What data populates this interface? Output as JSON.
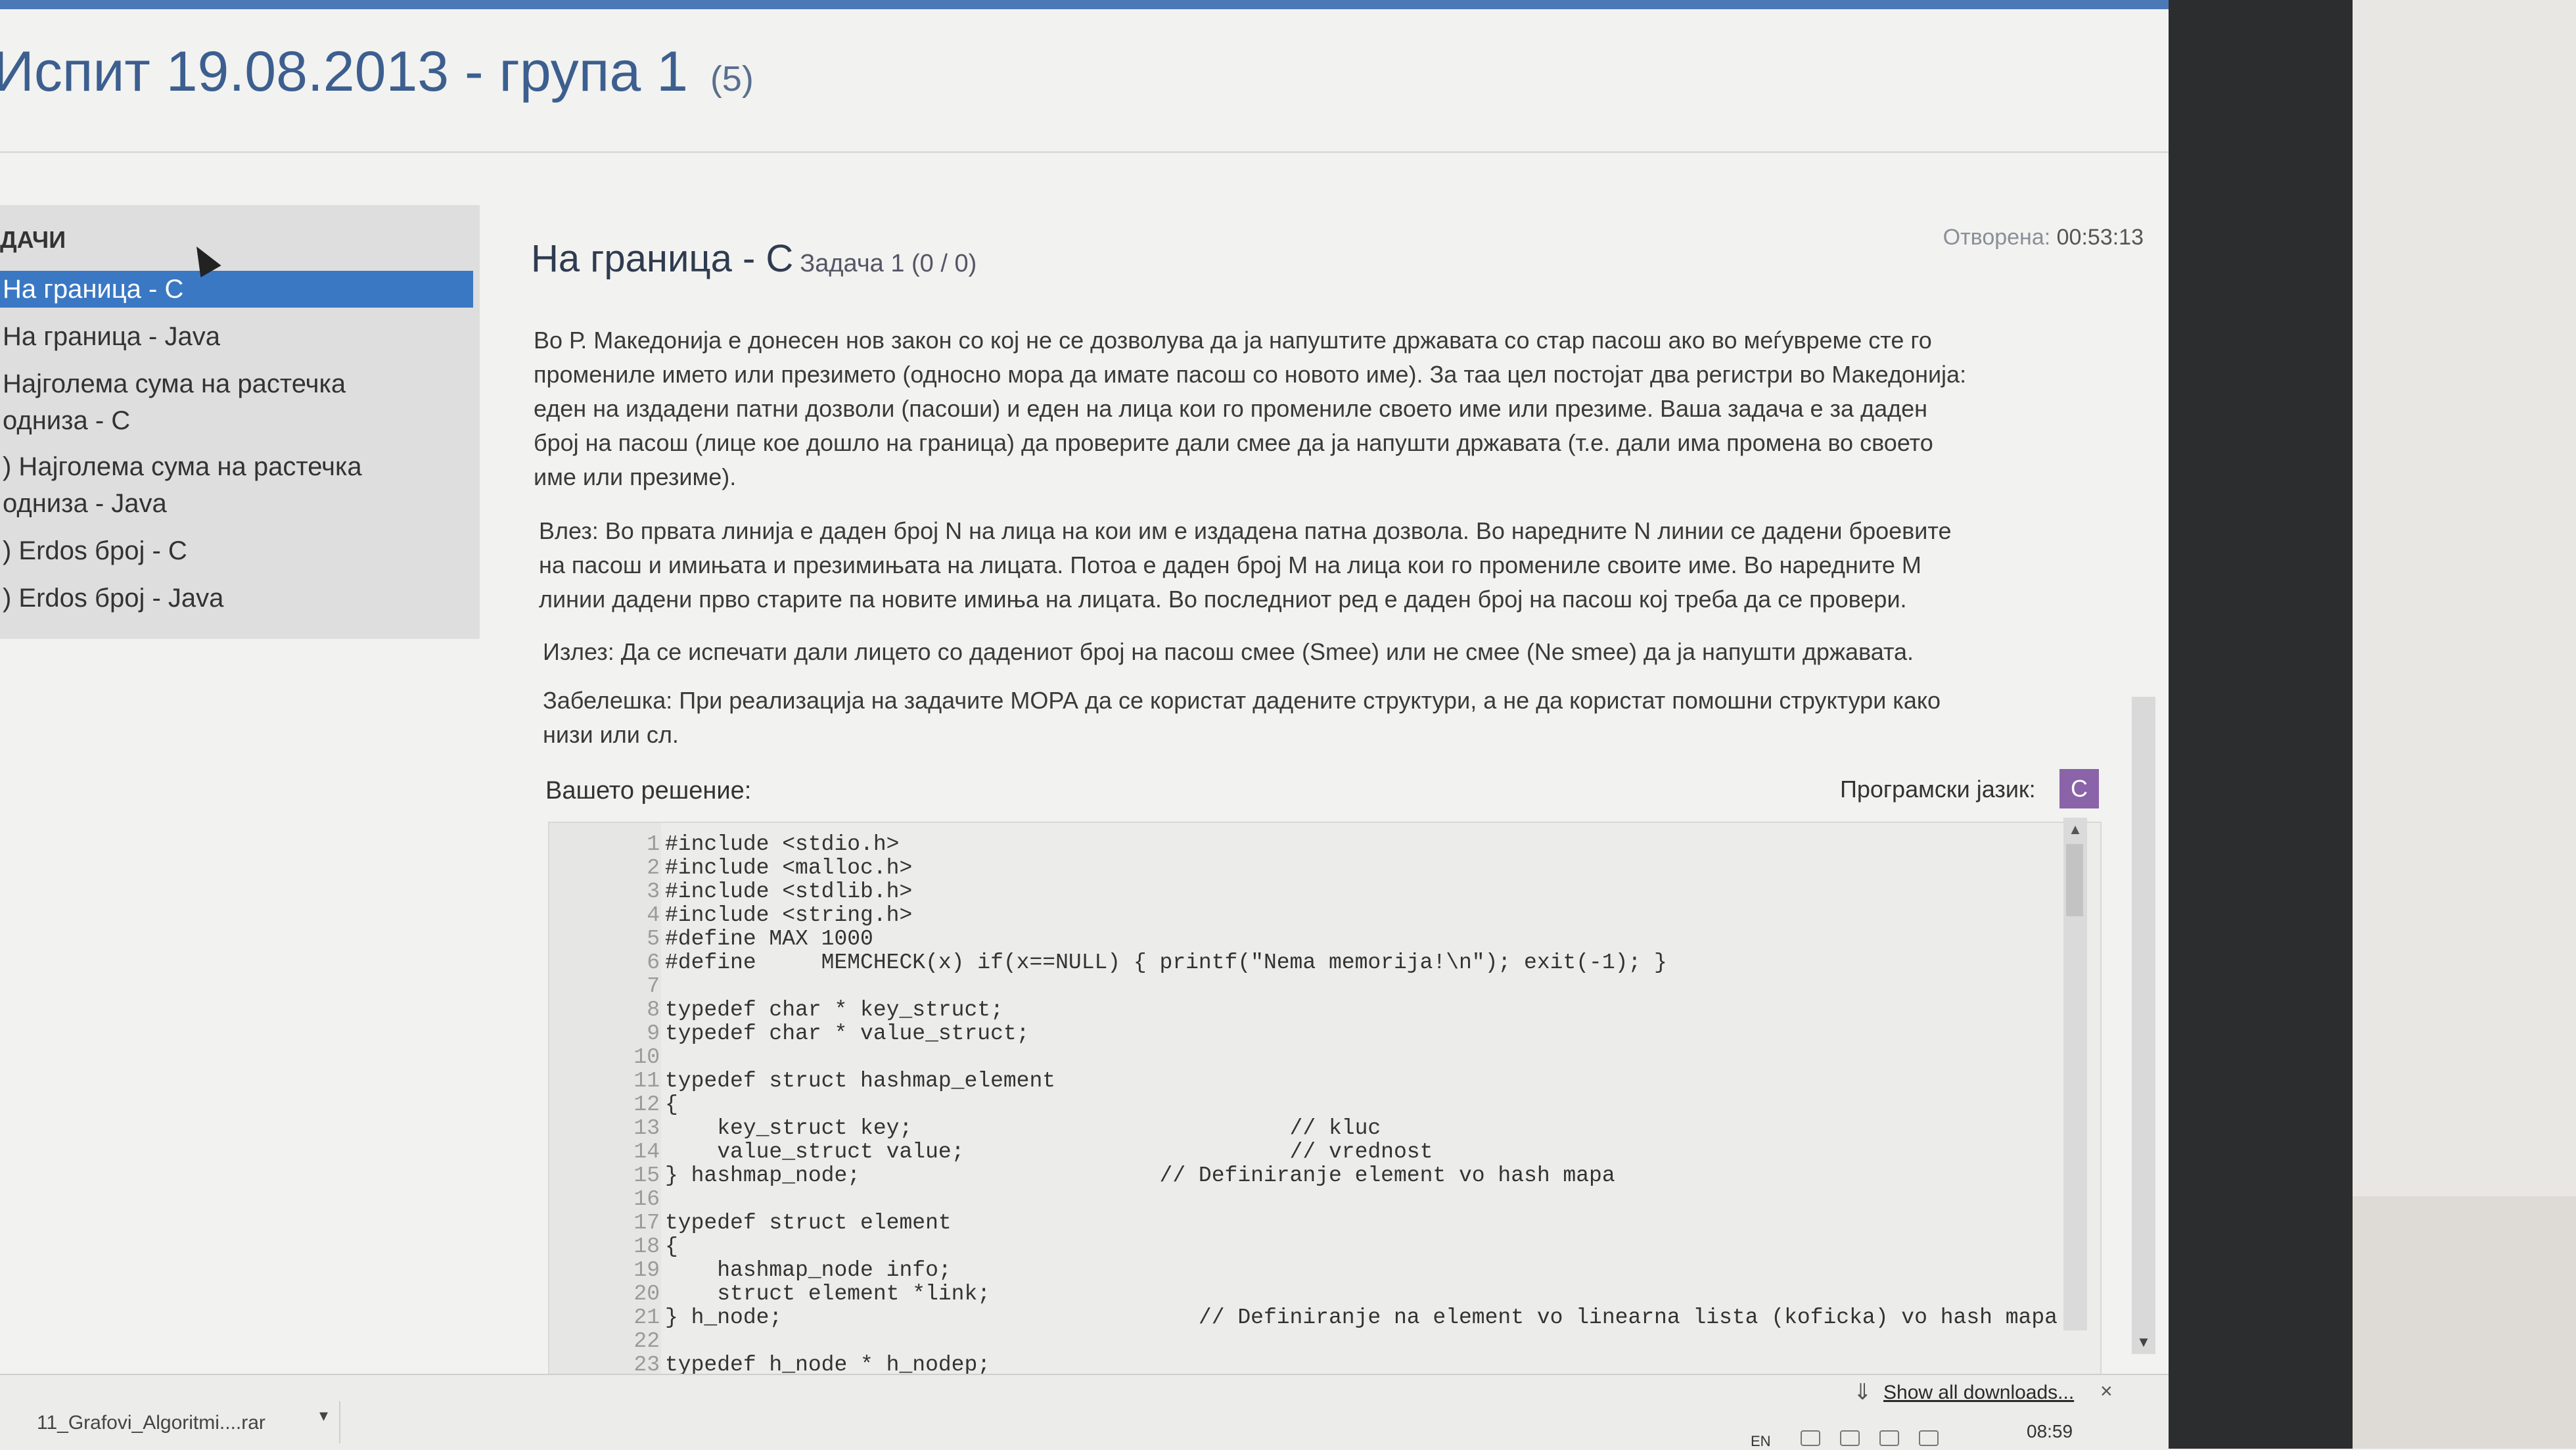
{
  "exam": {
    "title": "Испит 19.08.2013 - група 1",
    "count": "(5)"
  },
  "sidebar": {
    "heading": "ДАЧИ",
    "items": [
      {
        "label": "На граница - C"
      },
      {
        "label": "На граница - Java"
      },
      {
        "label": "Најголема сума на растечка"
      },
      {
        "label": "одниза - C"
      },
      {
        "label": ") Најголема сума на растечка"
      },
      {
        "label": "одниза - Java"
      },
      {
        "label": ") Erdos број - C"
      },
      {
        "label": ") Erdos број - Java"
      }
    ]
  },
  "task": {
    "title": "На граница - C",
    "subtitle": "Задача 1 (0 / 0)",
    "opened_label": "Отворена:",
    "opened_time": "00:53:13",
    "description": [
      "Во Р. Македонија е донесен нов закон со кој не се дозволува да ја напуштите државата со стар пасош ако во меѓувреме сте го",
      "промениле името или презимето (односно мора да имате пасош со новото име). За таа цел постојат два регистри во Македонија:",
      "еден на издадени патни дозволи (пасоши) и еден на лица кои го промениле своето име или презиме. Ваша задача е за даден",
      "број на пасош (лице кое дошло на граница) да проверите дали смее да ја напушти државата (т.е. дали има промена во своето",
      "име или презиме)."
    ],
    "input": [
      "Влез: Во првата линија е даден број N на лица на кои им е издадена патна дозвола. Во наредните N линии се дадени броевите",
      "на пасош и имињата и презимињата на лицата. Потоа е даден број M на лица кои го промениле своите име. Во наредните M",
      "линии дадени прво старите па новите имиња на лицата. Во последниот ред е даден број на пасош кој треба да се провери."
    ],
    "output": "Излез: Да се испечати дали лицето со дадениот број на пасош смее (Smee) или не смее (Ne smee) да ја напушти државата.",
    "note": [
      "Забелешка: При реализација на задачите МОРА да се користат дадените структури, а не да користат помошни структури како",
      "низи или сл."
    ],
    "solution_label": "Вашето решение:",
    "language_label": "Програмски јазик:",
    "language": "C"
  },
  "code": [
    {
      "n": "1",
      "text": "#include <stdio.h>"
    },
    {
      "n": "2",
      "text": "#include <malloc.h>"
    },
    {
      "n": "3",
      "text": "#include <stdlib.h>"
    },
    {
      "n": "4",
      "text": "#include <string.h>"
    },
    {
      "n": "5",
      "text": "#define MAX 1000"
    },
    {
      "n": "6",
      "text": "#define     MEMCHECK(x) if(x==NULL) { printf(\"Nema memorija!\\n\"); exit(-1); }"
    },
    {
      "n": "7",
      "text": ""
    },
    {
      "n": "8",
      "text": "typedef char * key_struct;"
    },
    {
      "n": "9",
      "text": "typedef char * value_struct;"
    },
    {
      "n": "10",
      "text": ""
    },
    {
      "n": "11",
      "text": "typedef struct hashmap_element"
    },
    {
      "n": "12",
      "text": "{"
    },
    {
      "n": "13",
      "text": "    key_struct key;                             // kluc"
    },
    {
      "n": "14",
      "text": "    value_struct value;                         // vrednost"
    },
    {
      "n": "15",
      "text": "} hashmap_node;                       // Definiranje element vo hash mapa"
    },
    {
      "n": "16",
      "text": ""
    },
    {
      "n": "17",
      "text": "typedef struct element"
    },
    {
      "n": "18",
      "text": "{"
    },
    {
      "n": "19",
      "text": "    hashmap_node info;"
    },
    {
      "n": "20",
      "text": "    struct element *link;"
    },
    {
      "n": "21",
      "text": "} h_node;                                // Definiranje na element vo linearna lista (koficka) vo hash mapa"
    },
    {
      "n": "22",
      "text": ""
    },
    {
      "n": "23",
      "text": "typedef h_node * h_nodep;"
    }
  ],
  "downloads": {
    "file": "11_Grafovi_Algoritmi....rar",
    "show_all": "Show all downloads...",
    "close": "×"
  },
  "taskbar": {
    "time": "08:59",
    "lang": "EN"
  },
  "colors": {
    "accent": "#3a78c3",
    "title": "#3c5f8f",
    "language_badge": "#8a63a8"
  }
}
